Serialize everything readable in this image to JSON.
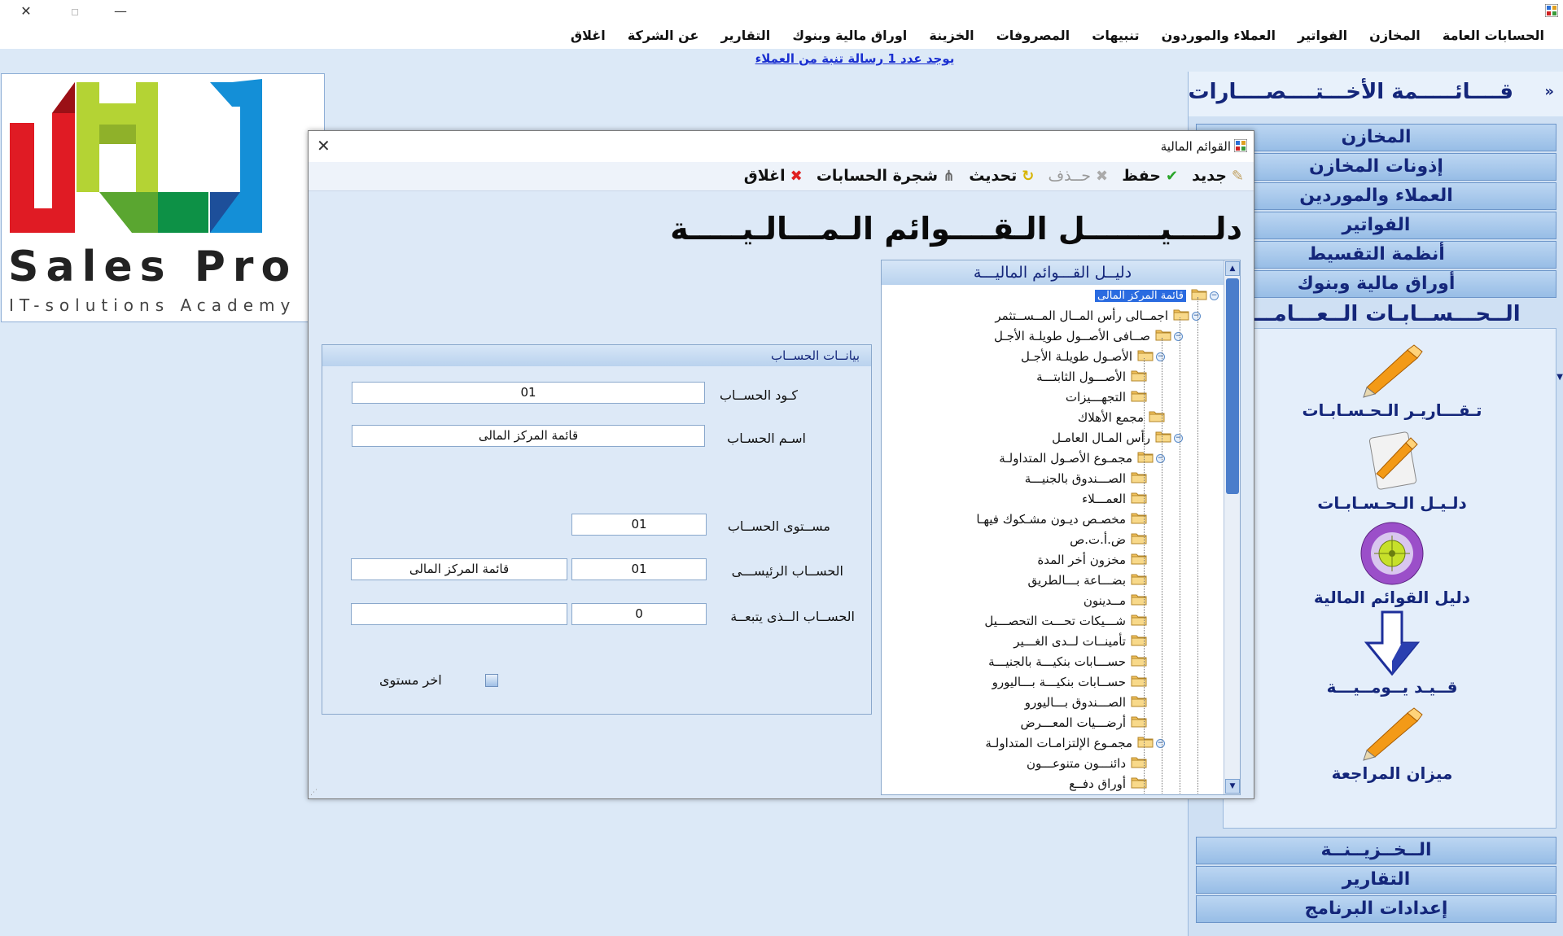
{
  "menu": [
    "الحسابات العامة",
    "المخازن",
    "الفواتير",
    "العملاء والموردون",
    "تنبيهات",
    "المصروفات",
    "الخزينة",
    "اوراق مالية وبنوك",
    "التقارير",
    "عن الشركة",
    "اغلاق"
  ],
  "notice": "يوجد عدد  1 رسالة تنبة من العملاء",
  "logo": {
    "name": "Sales Pro",
    "tagline": "IT-solutions Academy"
  },
  "sidebar": {
    "title": "قــــائـــــمة الأخـــتــــصــــارات",
    "toggle": "»",
    "categories_top": [
      "المخازن",
      "إذونات المخازن",
      "العملاء والموردين",
      "الفواتير",
      "أنظمة التقسيط",
      "أوراق مالية وبنوك"
    ],
    "active": "الــحـــســابـات الــعـــامــــة",
    "items": [
      "تـقـــاريـر الـحـسـابـات",
      "دلـيـل الـحـسـابـات",
      "دليل القوائم المالية",
      "قــيـد يــومــيـــة",
      "ميزان المراجعة"
    ],
    "categories_bottom": [
      "الــخــزيــنــة",
      "التقارير",
      "إعدادات البرنامج"
    ]
  },
  "dialog": {
    "title": "القوائم المالية",
    "toolbar": {
      "new": "جديد",
      "save": "حفظ",
      "delete": "حــذف",
      "refresh": "تحديث",
      "tree": "شجرة الحسابات",
      "close": "اغلاق"
    },
    "heading": "دلــــيـــــــل الـقــــوائم الـمـــالـيـــــة",
    "tree_header": "دليــل القـــوائم الماليـــة",
    "tree": [
      {
        "text": "قائمة المركز المالى",
        "level": 0,
        "expanded": true,
        "selected": true
      },
      {
        "text": "اجمــالى رأس المــال المــســتثمر",
        "level": 1,
        "expanded": true
      },
      {
        "text": "صــافى الأصــول طويلـة الأجـل",
        "level": 2,
        "expanded": true
      },
      {
        "text": "الأصـول طويلـة الأجـل",
        "level": 3,
        "expanded": true
      },
      {
        "text": "الأصـــول الثابتـــة",
        "level": 4
      },
      {
        "text": "التجهـــيزات",
        "level": 4
      },
      {
        "text": "مجمع الأهلاك",
        "level": 3
      },
      {
        "text": "رأس المـال العامـل",
        "level": 2,
        "expanded": true
      },
      {
        "text": "مجمـوع الأصـول المتداولـة",
        "level": 3,
        "expanded": true
      },
      {
        "text": "الصـــندوق بالجنيـــة",
        "level": 4
      },
      {
        "text": "العمـــلاء",
        "level": 4
      },
      {
        "text": "مخصـص ديـون مشـكوك فيهـا",
        "level": 4
      },
      {
        "text": "ض.أ.ت.ص",
        "level": 4
      },
      {
        "text": "مخزون أخر المدة",
        "level": 4
      },
      {
        "text": "بضـــاعة بـــالطريق",
        "level": 4
      },
      {
        "text": "مــدينون",
        "level": 4
      },
      {
        "text": "شـــيكات تحـــت التحصـــيل",
        "level": 4
      },
      {
        "text": "تأمينــات لــدى الغـــير",
        "level": 4
      },
      {
        "text": "حســـابات بنكيـــة بالجنيـــة",
        "level": 4
      },
      {
        "text": "حســابات بنكيـــة بـــاليورو",
        "level": 4
      },
      {
        "text": "الصـــندوق بـــاليورو",
        "level": 4
      },
      {
        "text": "أرضـــيات المعـــرض",
        "level": 4
      },
      {
        "text": "مجمـوع الإلتزامـات المتداولـة",
        "level": 3,
        "expanded": true
      },
      {
        "text": "دائنـــون متنوعـــون",
        "level": 4
      },
      {
        "text": "أوراق دفــع",
        "level": 4
      }
    ],
    "account": {
      "header": "بيانــات الحســاب",
      "code_label": "كـود الحســاب",
      "code": "01",
      "name_label": "اسـم الحسـاب",
      "name": "قائمة المركز المالى",
      "level_label": "مســتوى الحســاب",
      "level": "01",
      "parent_label": "الحســاب الرئيســـى",
      "parent_code": "01",
      "parent_name": "قائمة المركز المالى",
      "follows_label": "الحســاب الــذى يتبعــة",
      "follows_code": "0",
      "follows_name": "",
      "last_level_label": "اخر مستوى"
    }
  },
  "colors": {
    "accent_blue": "#14267a",
    "selection": "#2a6be0",
    "background": "#dce9f7"
  }
}
